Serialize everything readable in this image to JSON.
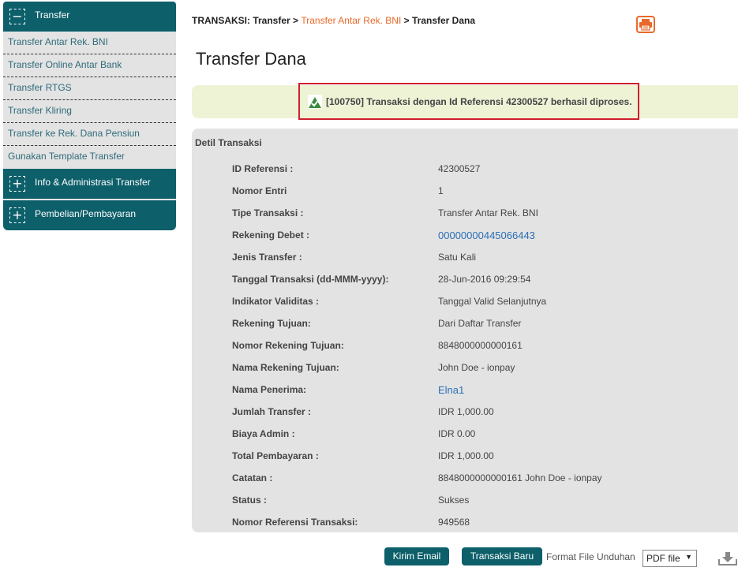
{
  "sidebar": {
    "transfer_section": {
      "toggle": "−",
      "label": "Transfer"
    },
    "items": [
      {
        "label": "Transfer Antar Rek. BNI"
      },
      {
        "label": "Transfer Online Antar Bank"
      },
      {
        "label": "Transfer RTGS"
      },
      {
        "label": "Transfer Kliring"
      },
      {
        "label": "Transfer ke Rek. Dana Pensiun"
      },
      {
        "label": "Gunakan Template Transfer"
      }
    ],
    "info_section": {
      "toggle": "+",
      "label": "Info & Administrasi Transfer"
    },
    "payment_section": {
      "toggle": "+",
      "label": "Pembelian/Pembayaran"
    }
  },
  "breadcrumb": {
    "prefix": "TRANSAKSI: Transfer > ",
    "active": "Transfer Antar Rek. BNI",
    "suffix": " > Transfer Dana"
  },
  "page_title": "Transfer Dana",
  "notice": {
    "text": "[100750] Transaksi dengan Id Referensi 42300527 berhasil diproses.",
    "icon": "success-check-icon",
    "box_color": "#cf1f2e"
  },
  "details": {
    "title": "Detil Transaksi",
    "rows": [
      {
        "label": "ID Referensi :",
        "value": "42300527"
      },
      {
        "label": "Nomor Entri",
        "value": "1"
      },
      {
        "label": "Tipe Transaksi :",
        "value": "Transfer Antar Rek. BNI"
      },
      {
        "label": "Rekening Debet :",
        "value": "00000000445066443"
      },
      {
        "label": "Jenis Transfer :",
        "value": "Satu Kali"
      },
      {
        "label": "Tanggal Transaksi (dd-MMM-yyyy):",
        "value": "28-Jun-2016 09:29:54"
      },
      {
        "label": "Indikator Validitas :",
        "value": "Tanggal Valid Selanjutnya"
      },
      {
        "label": "Rekening Tujuan:",
        "value": "Dari Daftar Transfer"
      },
      {
        "label": "Nomor Rekening Tujuan:",
        "value": "8848000000000161"
      },
      {
        "label": "Nama Rekening Tujuan:",
        "value": "John Doe - ionpay"
      },
      {
        "label": "Nama Penerima:",
        "value": "Elna1"
      },
      {
        "label": "Jumlah Transfer :",
        "value": "IDR 1,000.00"
      },
      {
        "label": "Biaya Admin :",
        "value": "IDR 0.00"
      },
      {
        "label": "Total Pembayaran :",
        "value": "IDR 1,000.00"
      },
      {
        "label": "Catatan :",
        "value": "8848000000000161 John Doe - ionpay"
      },
      {
        "label": "Status :",
        "value": "Sukses"
      },
      {
        "label": "Nomor Referensi Transaksi:",
        "value": "949568"
      }
    ]
  },
  "footer": {
    "email_button": "Kirim Email",
    "new_transaction_button": "Transaksi Baru",
    "format_label": "Format File Unduhan",
    "format_selected": "PDF file"
  },
  "colors": {
    "brand": "#0d5f6a",
    "accent": "#e8692b",
    "link": "#2a6fb5"
  }
}
